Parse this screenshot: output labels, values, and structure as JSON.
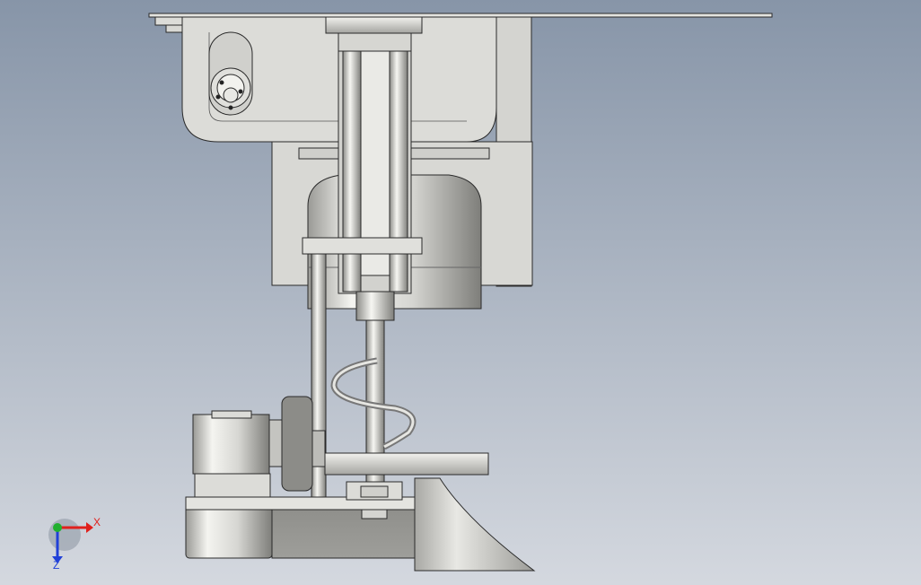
{
  "viewport": {
    "background_top": "#8795a8",
    "background_bottom": "#d4d8df"
  },
  "model": {
    "edge_color": "#2a2a2a",
    "plate_color": "#d9d9d6",
    "metal_light": "#f0f0ec",
    "metal_mid": "#c8c8c4",
    "metal_dark": "#8a8a86",
    "shadow_color": "#9a9a96"
  },
  "triad": {
    "x_label": "X",
    "z_label": "Z",
    "x_color": "#e0201c",
    "y_color": "#22b030",
    "z_color": "#2040d8"
  }
}
